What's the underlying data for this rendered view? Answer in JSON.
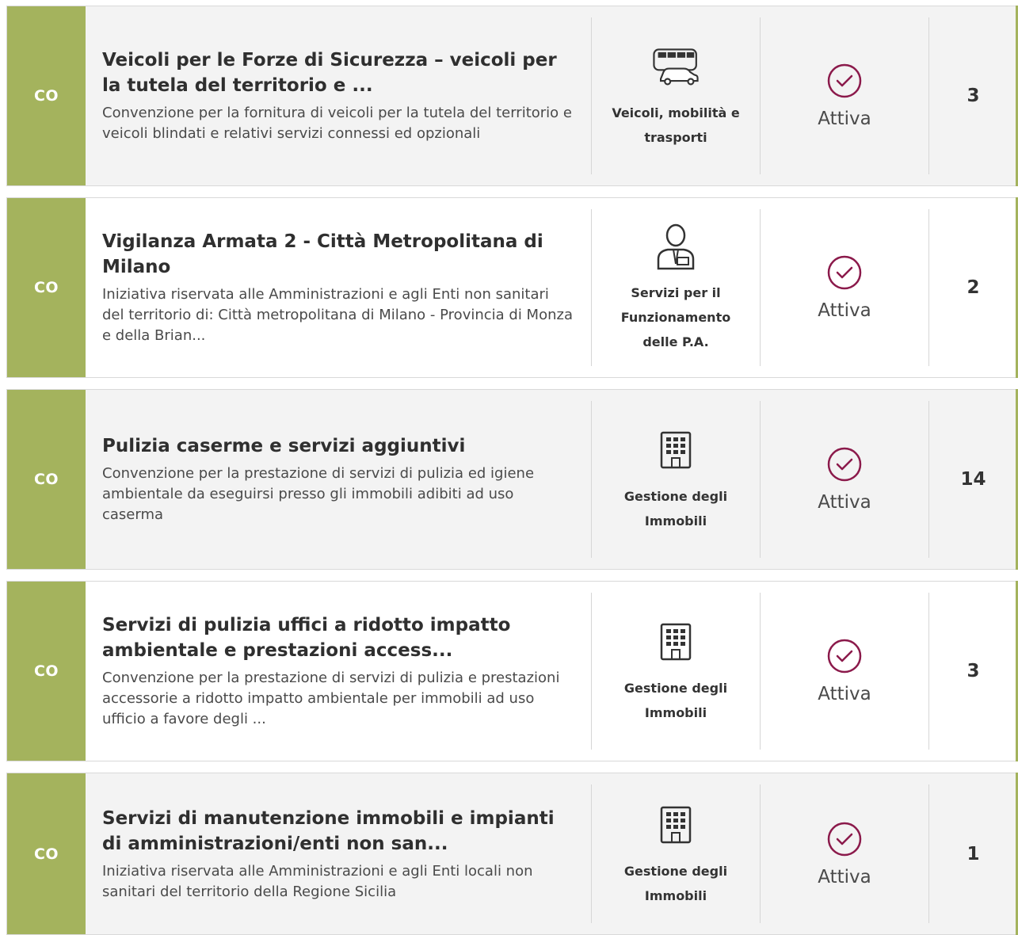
{
  "colors": {
    "accent": "#a4b35d",
    "status": "#8b1a4b"
  },
  "items": [
    {
      "badge": "CO",
      "title": "Veicoli per le Forze di Sicurezza – veicoli per la tutela del territorio e ...",
      "description": "Convenzione per la fornitura di veicoli per la tutela del territorio e veicoli blindati e relativi servizi connessi ed opzionali",
      "category_icon": "vehicles-icon",
      "category": "Veicoli, mobilità e trasporti",
      "status": "Attiva",
      "count": "3"
    },
    {
      "badge": "CO",
      "title": "Vigilanza Armata 2 - Città Metropolitana di Milano",
      "description": "Iniziativa riservata alle Amministrazioni e agli Enti non sanitari del territorio di: Città metropolitana di Milano - Provincia di Monza e della Brian...",
      "category_icon": "person-icon",
      "category": "Servizi per il Funzionamento delle P.A.",
      "status": "Attiva",
      "count": "2"
    },
    {
      "badge": "CO",
      "title": "Pulizia caserme e servizi aggiuntivi",
      "description": "Convenzione per la prestazione di servizi di pulizia ed igiene ambientale da eseguirsi presso gli immobili adibiti ad uso caserma",
      "category_icon": "building-icon",
      "category": "Gestione degli Immobili",
      "status": "Attiva",
      "count": "14"
    },
    {
      "badge": "CO",
      "title": "Servizi di pulizia uffici a ridotto impatto ambientale e prestazioni access...",
      "description": "Convenzione per la prestazione di servizi di pulizia e prestazioni accessorie a ridotto impatto ambientale per immobili ad uso ufficio a favore degli ...",
      "category_icon": "building-icon",
      "category": "Gestione degli Immobili",
      "status": "Attiva",
      "count": "3"
    },
    {
      "badge": "CO",
      "title": "Servizi di manutenzione immobili e impianti di amministrazioni/enti non san...",
      "description": "Iniziativa riservata alle Amministrazioni e agli Enti locali non sanitari del territorio della Regione Sicilia",
      "category_icon": "building-icon",
      "category": "Gestione degli Immobili",
      "status": "Attiva",
      "count": "1"
    }
  ]
}
